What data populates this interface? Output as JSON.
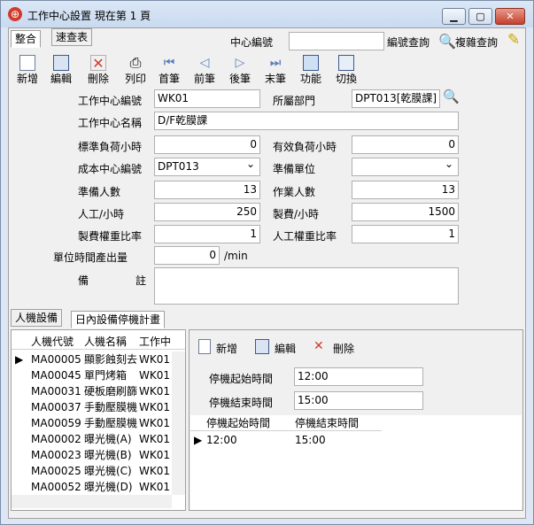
{
  "window": {
    "title": "工作中心設置 現在第 1 頁"
  },
  "tabs_top": [
    {
      "label": "整合"
    },
    {
      "label": "速查表"
    }
  ],
  "search": {
    "label": "中心編號",
    "value": "",
    "btn1": "編號查詢",
    "btn2": "複雜查詢"
  },
  "toolbar": [
    {
      "label": "新增",
      "icon": "new-icon"
    },
    {
      "label": "編輯",
      "icon": "edit-icon"
    },
    {
      "label": "刪除",
      "icon": "delete-icon"
    },
    {
      "label": "列印",
      "icon": "print-icon"
    },
    {
      "label": "首筆",
      "icon": "first-icon"
    },
    {
      "label": "前筆",
      "icon": "prev-icon"
    },
    {
      "label": "後筆",
      "icon": "next-icon"
    },
    {
      "label": "末筆",
      "icon": "last-icon"
    },
    {
      "label": "功能",
      "icon": "function-icon"
    },
    {
      "label": "切換",
      "icon": "switch-icon"
    }
  ],
  "form": {
    "center_no": {
      "label": "工作中心編號",
      "value": "WK01"
    },
    "dept": {
      "label": "所屬部門",
      "value": "DPT013[乾膜課]"
    },
    "center_name": {
      "label": "工作中心名稱",
      "value": "D/F乾膜課"
    },
    "std_hours": {
      "label": "標準負荷小時",
      "value": "0"
    },
    "eff_hours": {
      "label": "有效負荷小時",
      "value": "0"
    },
    "cost_center": {
      "label": "成本中心編號",
      "value": "DPT013"
    },
    "prep_unit": {
      "label": "準備單位",
      "value": ""
    },
    "prep_people": {
      "label": "準備人數",
      "value": "13"
    },
    "work_people": {
      "label": "作業人數",
      "value": "13"
    },
    "labor_hour": {
      "label": "人工/小時",
      "value": "250"
    },
    "mfg_hour": {
      "label": "製費/小時",
      "value": "1500"
    },
    "mfg_weight": {
      "label": "製費權重比率",
      "value": "1"
    },
    "labor_weight": {
      "label": "人工權重比率",
      "value": "1"
    },
    "unit_output": {
      "label": "單位時間產出量",
      "value": "0",
      "unit": "/min"
    },
    "remark": {
      "label1": "備",
      "label2": "註",
      "value": ""
    }
  },
  "tabs_bottom": [
    {
      "label": "人機設備"
    },
    {
      "label": "日內設備停機計畫"
    }
  ],
  "machine_grid": {
    "headers": [
      "人機代號",
      "人機名稱",
      "工作中"
    ],
    "rows": [
      [
        "MA00005",
        "顯影蝕刻去",
        "WK01"
      ],
      [
        "MA00045",
        "單門烤箱",
        "WK01"
      ],
      [
        "MA00031",
        "硬板磨刷篩",
        "WK01"
      ],
      [
        "MA00037",
        "手動壓膜機",
        "WK01"
      ],
      [
        "MA00059",
        "手動壓膜機",
        "WK01"
      ],
      [
        "MA00002",
        "曝光機(A)",
        "WK01"
      ],
      [
        "MA00023",
        "曝光機(B)",
        "WK01"
      ],
      [
        "MA00025",
        "曝光機(C)",
        "WK01"
      ],
      [
        "MA00052",
        "曝光機(D)",
        "WK01"
      ]
    ]
  },
  "sub_toolbar": {
    "add": "新增",
    "edit": "編輯",
    "delete": "刪除"
  },
  "stop": {
    "start_label": "停機起始時間",
    "start_value": "12:00",
    "end_label": "停機結束時間",
    "end_value": "15:00"
  },
  "stop_grid": {
    "headers": [
      "停機起始時間",
      "停機結束時間"
    ],
    "rows": [
      [
        "12:00",
        "15:00"
      ]
    ]
  }
}
